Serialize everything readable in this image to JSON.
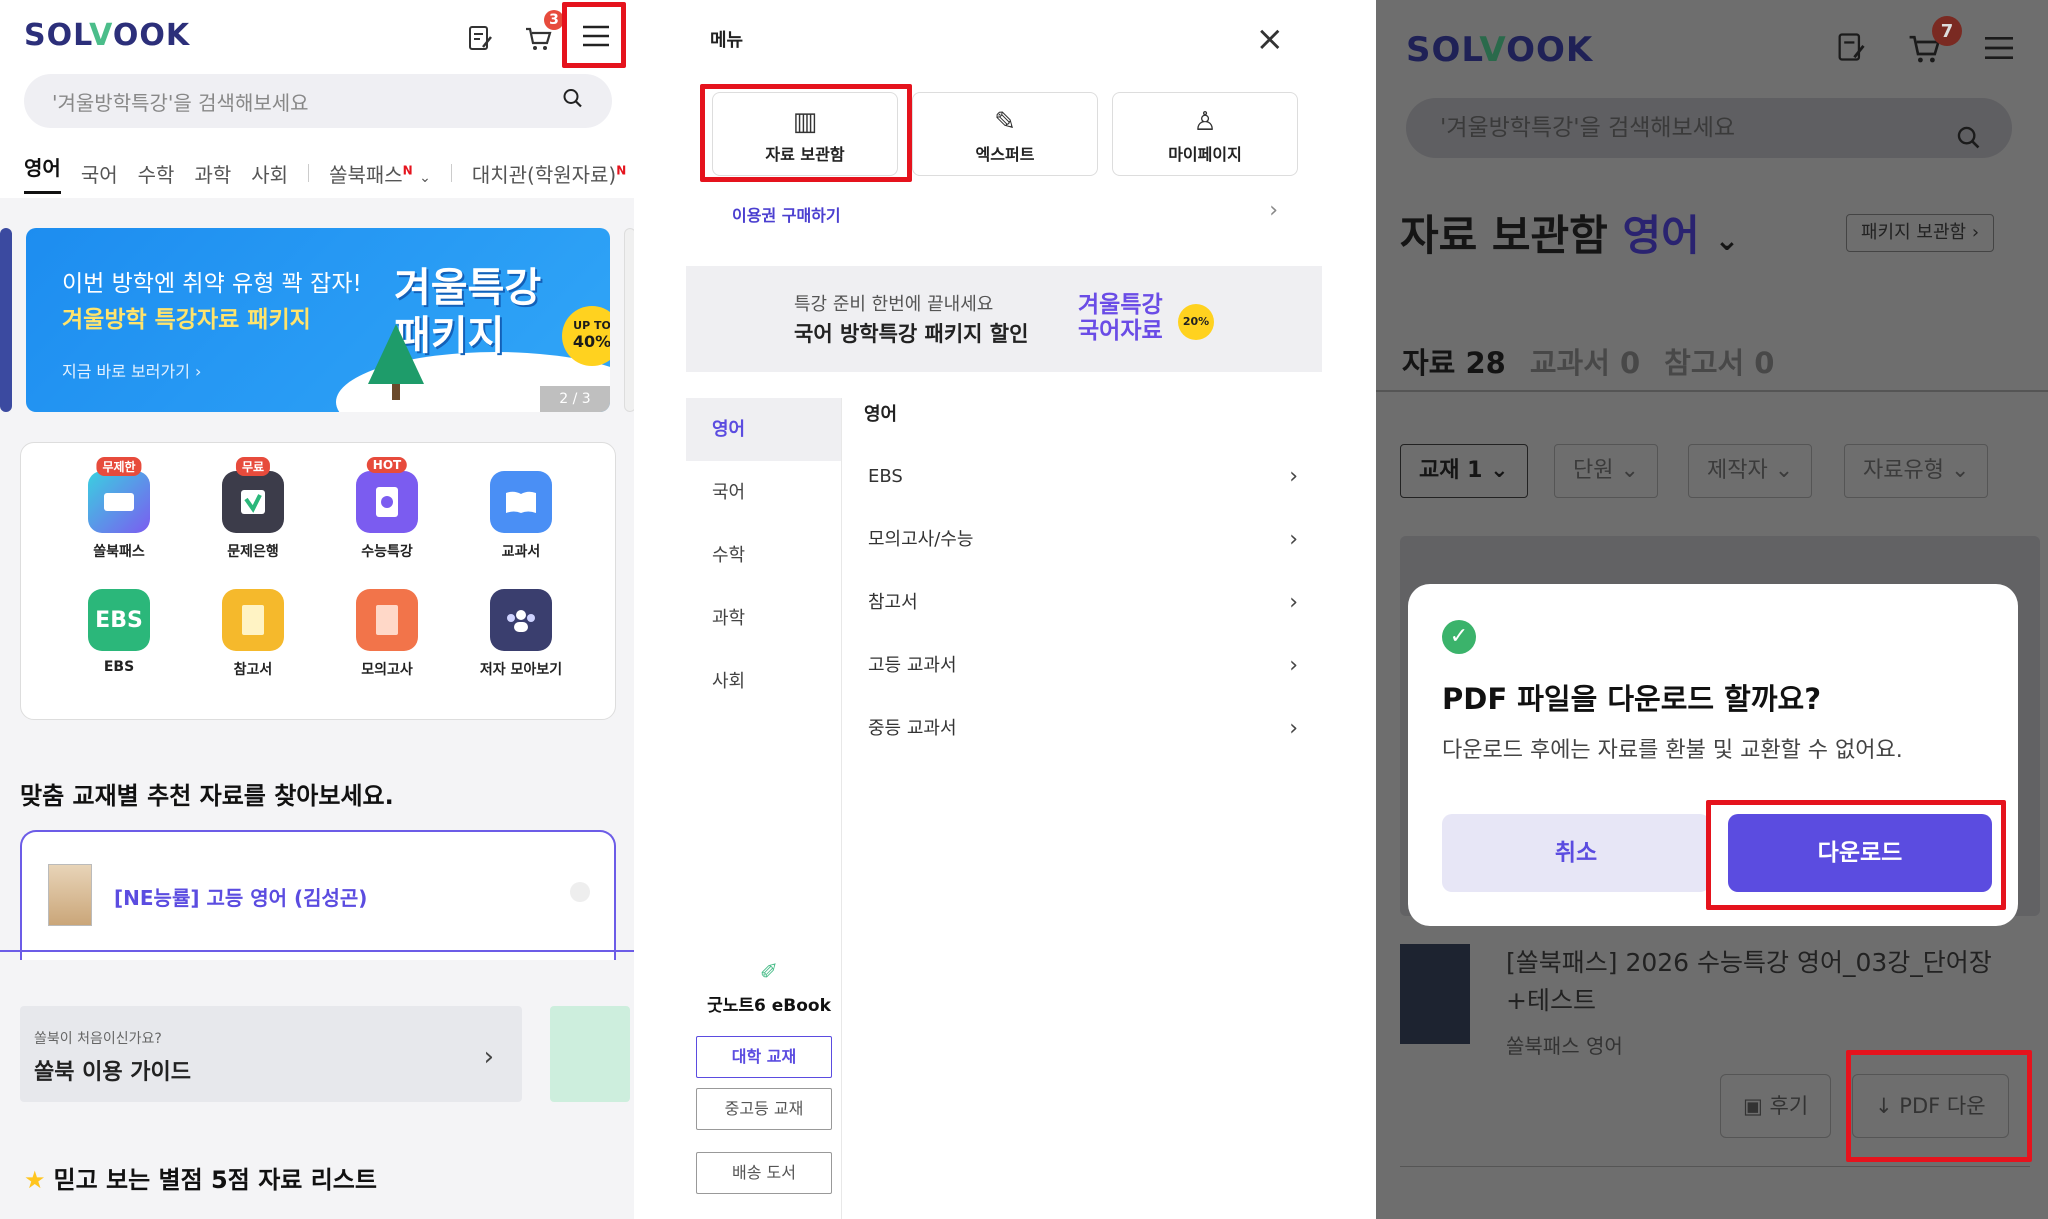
{
  "panel1": {
    "logo": "SOLBOOK",
    "cart_count": "3",
    "search_placeholder": "'겨울방학특강'을 검색해보세요",
    "tabs": [
      "영어",
      "국어",
      "수학",
      "과학",
      "사회"
    ],
    "tab_pass": "쏠북패스",
    "tab_pass_sup": "N",
    "tab_academy": "대치관(학원자료)",
    "tab_academy_sup": "N",
    "banner": {
      "line1": "이번 방학엔 취약 유형 꽉 잡자!",
      "line2": "겨울방학 특강자료 패키지",
      "link": "지금 바로 보러가기 ›",
      "big1": "겨울특강",
      "big2": "패키지",
      "upto1": "UP TO",
      "upto2": "40%",
      "pager": "2 / 3"
    },
    "grid": [
      {
        "label": "쏠북패스",
        "tag": "무제한",
        "icon": "ticket-icon",
        "color": "#4aa3f5"
      },
      {
        "label": "문제은행",
        "tag": "무료",
        "icon": "bank-icon",
        "color": "#3c3c4a"
      },
      {
        "label": "수능특강",
        "tag": "HOT",
        "icon": "fire-book-icon",
        "color": "#7b5cf0"
      },
      {
        "label": "교과서",
        "tag": "",
        "icon": "open-book-icon",
        "color": "#4a8ff5"
      },
      {
        "label": "EBS",
        "tag": "",
        "icon": "ebs-icon",
        "color": "#2bb77a",
        "glyph": "EBS"
      },
      {
        "label": "참고서",
        "tag": "",
        "icon": "reference-book-icon",
        "color": "#f5b92c"
      },
      {
        "label": "모의고사",
        "tag": "",
        "icon": "exam-icon",
        "color": "#f2744a"
      },
      {
        "label": "저자 모아보기",
        "tag": "",
        "icon": "authors-icon",
        "color": "#3a3e6e"
      }
    ],
    "section_title": "맞춤 교재별 추천 자료를 찾아보세요.",
    "book_title": "[NE능률] 고등 영어 (김성곤)",
    "guide_small": "쏠북이 처음이신가요?",
    "guide_big": "쏠북 이용 가이드",
    "star_title": "믿고 보는 별점 5점 자료 리스트"
  },
  "panel2": {
    "menu_title": "메뉴",
    "quick": [
      {
        "label": "자료 보관함",
        "icon": "archive-icon"
      },
      {
        "label": "엑스퍼트",
        "icon": "expert-icon"
      },
      {
        "label": "마이페이지",
        "icon": "user-icon"
      }
    ],
    "buy_pass": "이용권 구매하기",
    "promo": {
      "small": "특강 준비 한번에 끝내세요",
      "big": "국어 방학특강 패키지 할인",
      "brand1": "겨울특강",
      "brand2": "국어자료",
      "discount": "20%"
    },
    "subjects": [
      "영어",
      "국어",
      "수학",
      "과학",
      "사회"
    ],
    "active_subject_title": "영어",
    "submenu": [
      "EBS",
      "모의고사/수능",
      "참고서",
      "고등 교과서",
      "중등 교과서"
    ],
    "goodnote": "굿노트6 eBook",
    "goodnote_buttons": [
      "대학 교재",
      "중고등 교재",
      "배송 도서"
    ]
  },
  "panel3": {
    "logo": "SOLBOOK",
    "cart_count": "7",
    "search_placeholder": "'겨울방학특강'을 검색해보세요",
    "heading": "자료 보관함",
    "heading_subject": "영어",
    "package_button": "패키지 보관함",
    "tabs": [
      "자료 28",
      "교과서 0",
      "참고서 0"
    ],
    "filters": [
      "교재 1",
      "단원",
      "제작자",
      "자료유형"
    ],
    "book_title": "[쏠북패스] 2026 수능특강 영어_03강_단어장+테스트",
    "book_sub": "쏠북패스 영어",
    "review_button": "후기",
    "pdf_button": "PDF 다운",
    "modal": {
      "title": "PDF 파일을 다운로드 할까요?",
      "desc": "다운로드 후에는 자료를 환불 및 교환할 수 없어요.",
      "cancel": "취소",
      "confirm": "다운로드"
    }
  }
}
